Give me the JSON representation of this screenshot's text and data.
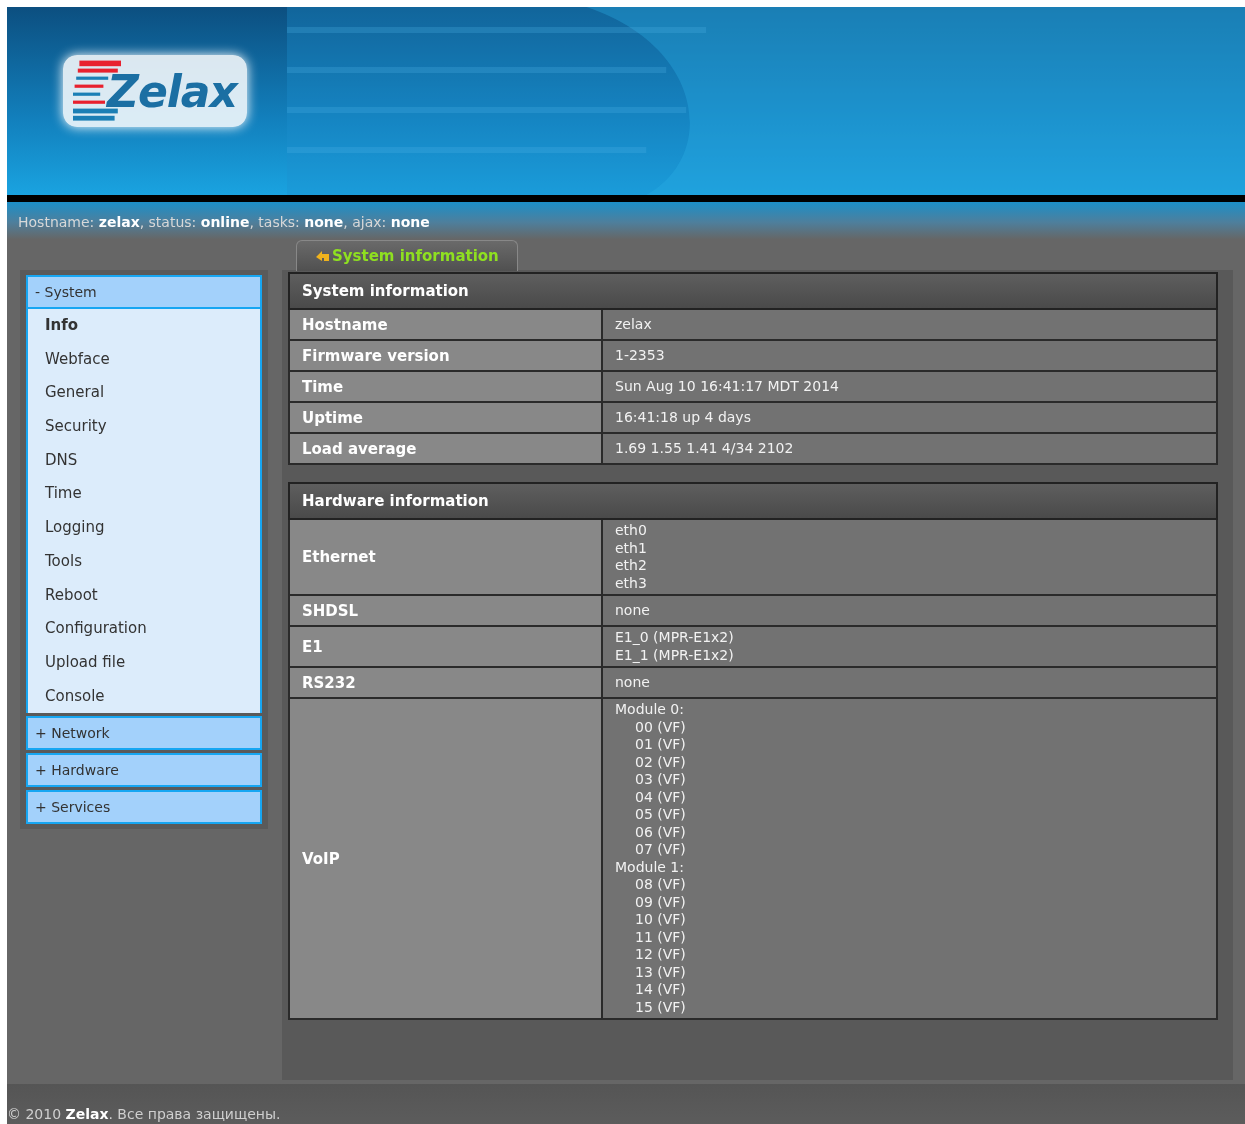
{
  "logo": {
    "text": "Zelax"
  },
  "status_line": "Hostname: **zelax**, status: **online**, tasks: **none**, ajax: **none**",
  "tabs": [
    {
      "label": "System information",
      "selected": true
    }
  ],
  "sidebar": {
    "sections": [
      {
        "toggle": "-",
        "label": "System",
        "items": [
          {
            "label": "Info",
            "selected": true
          },
          {
            "label": "Webface",
            "selected": false
          },
          {
            "label": "General",
            "selected": false
          },
          {
            "label": "Security",
            "selected": false
          },
          {
            "label": "DNS",
            "selected": false
          },
          {
            "label": "Time",
            "selected": false
          },
          {
            "label": "Logging",
            "selected": false
          },
          {
            "label": "Tools",
            "selected": false
          },
          {
            "label": "Reboot",
            "selected": false
          },
          {
            "label": "Configuration",
            "selected": false
          },
          {
            "label": "Upload file",
            "selected": false
          },
          {
            "label": "Console",
            "selected": false
          }
        ]
      },
      {
        "toggle": "+",
        "label": "Network"
      },
      {
        "toggle": "+",
        "label": "Hardware"
      },
      {
        "toggle": "+",
        "label": "Services"
      }
    ]
  },
  "tables": [
    {
      "title": "System information",
      "rows": [
        {
          "label": "Hostname",
          "kind": "lines",
          "lines": [
            "zelax"
          ]
        },
        {
          "label": "Firmware version",
          "kind": "lines",
          "lines": [
            "1-2353"
          ]
        },
        {
          "label": "Time",
          "kind": "lines",
          "lines": [
            "Sun Aug 10 16:41:17 MDT 2014"
          ]
        },
        {
          "label": "Uptime",
          "kind": "lines",
          "lines": [
            "16:41:18 up 4 days"
          ]
        },
        {
          "label": "Load average",
          "kind": "lines",
          "lines": [
            "1.69 1.55 1.41 4/34 2102"
          ]
        }
      ]
    },
    {
      "title": "Hardware information",
      "rows": [
        {
          "label": "Ethernet",
          "kind": "lines",
          "lines": [
            "eth0",
            "eth1",
            "eth2",
            "eth3"
          ]
        },
        {
          "label": "SHDSL",
          "kind": "lines",
          "lines": [
            "none"
          ]
        },
        {
          "label": "E1",
          "kind": "lines",
          "lines": [
            "E1_0 (MPR-E1x2)",
            "E1_1 (MPR-E1x2)"
          ]
        },
        {
          "label": "RS232",
          "kind": "lines",
          "lines": [
            "none"
          ]
        },
        {
          "label": "VoIP",
          "kind": "modules",
          "modules": [
            {
              "name": "Module 0:",
              "ports": [
                "00 (VF)",
                "01 (VF)",
                "02 (VF)",
                "03 (VF)",
                "04 (VF)",
                "05 (VF)",
                "06 (VF)",
                "07 (VF)"
              ]
            },
            {
              "name": "Module 1:",
              "ports": [
                "08 (VF)",
                "09 (VF)",
                "10 (VF)",
                "11 (VF)",
                "12 (VF)",
                "13 (VF)",
                "14 (VF)",
                "15 (VF)"
              ]
            }
          ]
        }
      ]
    }
  ],
  "footer": "© 2010 **Zelax**. Все права защищены."
}
